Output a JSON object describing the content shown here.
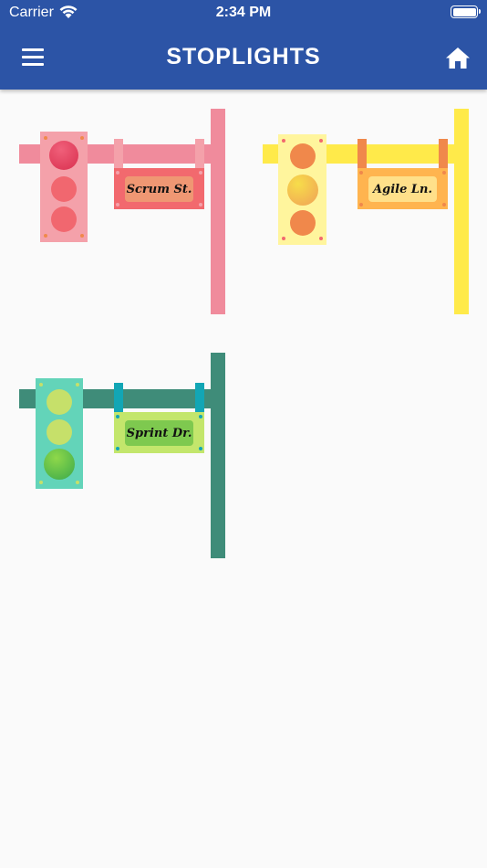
{
  "status_bar": {
    "carrier": "Carrier",
    "time": "2:34 PM"
  },
  "header": {
    "title": "STOPLIGHTS",
    "menu_icon": "hamburger-menu-icon",
    "home_icon": "home-icon",
    "color": "#2c54a6"
  },
  "stoplights": [
    {
      "street": "Scrum St.",
      "lit_lamp": "red",
      "colors": {
        "structure": "#f08b9c",
        "box": "#f4a1aa",
        "sign": "#f2696e",
        "plate": "#ef9773",
        "lamp_lit": "#e23d5c",
        "lamp_off": "#f1676f"
      }
    },
    {
      "street": "Agile Ln.",
      "lit_lamp": "yellow",
      "colors": {
        "structure": "#ffea4a",
        "box": "#fff59d",
        "sign": "#ffb44f",
        "plate": "#ffe08a",
        "strap": "#f0884b",
        "lamp_lit": "#f5c94a",
        "lamp_off": "#f0884b"
      }
    },
    {
      "street": "Sprint Dr.",
      "lit_lamp": "green",
      "colors": {
        "structure": "#3f8c79",
        "box": "#63d4b9",
        "sign": "#c3e66c",
        "plate": "#7ec94f",
        "strap": "#12a6b5",
        "lamp_lit": "#52b84a",
        "lamp_off": "#c6e06a"
      }
    }
  ]
}
